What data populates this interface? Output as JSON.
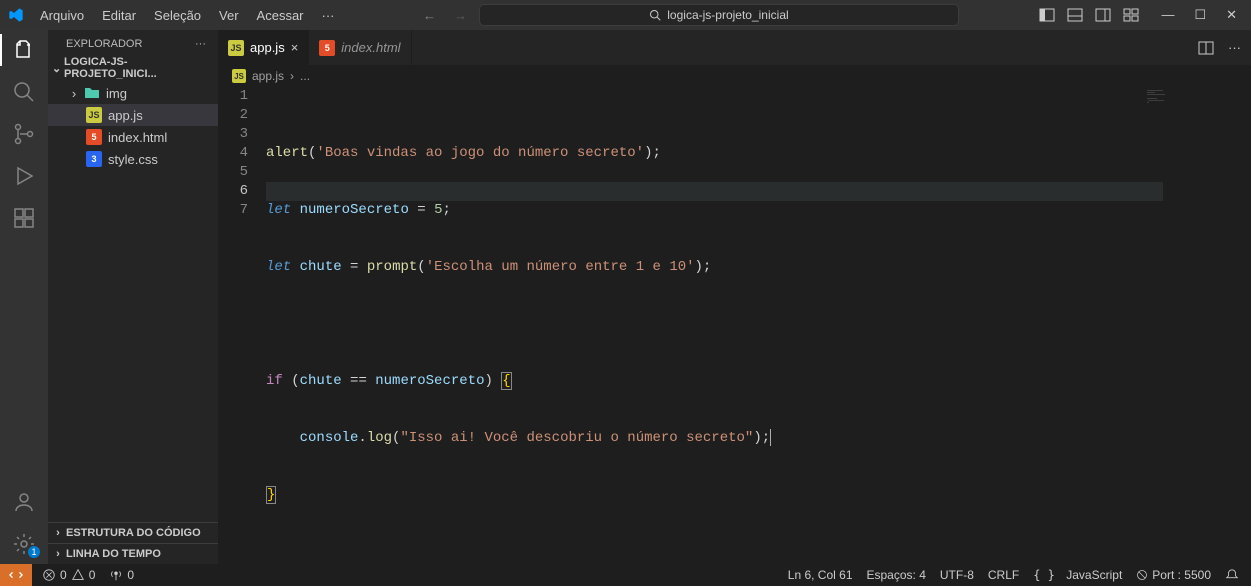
{
  "menu": {
    "arquivo": "Arquivo",
    "editar": "Editar",
    "selecao": "Seleção",
    "ver": "Ver",
    "acessar": "Acessar",
    "more": "···"
  },
  "search": {
    "placeholder": "logica-js-projeto_inicial"
  },
  "explorer": {
    "title": "EXPLORADOR",
    "project": "LOGICA-JS-PROJETO_INICI...",
    "items": {
      "img": "img",
      "appjs": "app.js",
      "indexhtml": "index.html",
      "stylecss": "style.css"
    },
    "outline": "ESTRUTURA DO CÓDIGO",
    "timeline": "LINHA DO TEMPO"
  },
  "tabs": {
    "appjs": "app.js",
    "indexhtml": "index.html"
  },
  "breadcrumb": {
    "icon": "JS",
    "file": "app.js",
    "sep": "›",
    "more": "..."
  },
  "code": {
    "l1": {
      "fn": "alert",
      "p1": "(",
      "str": "'Boas vindas ao jogo do número secreto'",
      "p2": ");"
    },
    "l2": {
      "kw": "let",
      "sp": " ",
      "var": "numeroSecreto",
      "op": " = ",
      "num": "5",
      "end": ";"
    },
    "l3": {
      "kw": "let",
      "sp": " ",
      "var": "chute",
      "op": " = ",
      "fn": "prompt",
      "p1": "(",
      "str": "'Escolha um número entre 1 e 10'",
      "p2": ");"
    },
    "l5": {
      "kw": "if",
      "sp": " ",
      "p1": "(",
      "v1": "chute",
      "op": " == ",
      "v2": "numeroSecreto",
      "p2": ") ",
      "br": "{"
    },
    "l6": {
      "indent": "    ",
      "obj": "console",
      "dot": ".",
      "fn": "log",
      "p1": "(",
      "str": "\"Isso ai! Você descobriu o número secreto\"",
      "p2": ");"
    },
    "l7": {
      "br": "}"
    }
  },
  "lines": [
    "1",
    "2",
    "3",
    "4",
    "5",
    "6",
    "7"
  ],
  "status": {
    "errors": "0",
    "warnings": "0",
    "ports": "0",
    "lncol": "Ln 6, Col 61",
    "spaces": "Espaços: 4",
    "enc": "UTF-8",
    "eol": "CRLF",
    "lang": "JavaScript",
    "port": "Port : 5500"
  },
  "settingsBadge": "1"
}
